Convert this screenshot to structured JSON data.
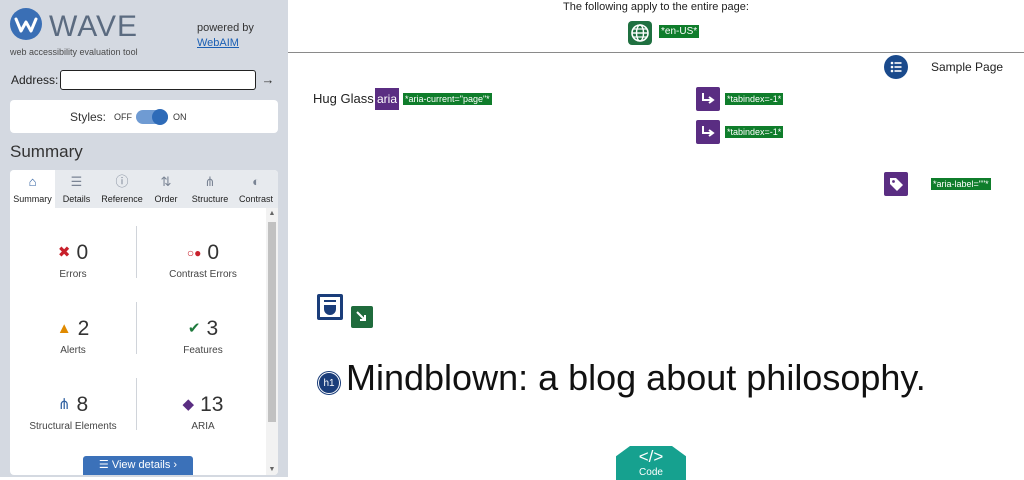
{
  "sidebar": {
    "logo_text": "WAVE",
    "logo_subtitle": "web accessibility evaluation tool",
    "powered_by": "powered by",
    "webaim_link": "WebAIM",
    "address_label": "Address:",
    "address_value": "",
    "go_arrow": "→",
    "styles_label": "Styles:",
    "styles_off": "OFF",
    "styles_on": "ON",
    "summary_title": "Summary",
    "tabs": [
      {
        "label": "Summary",
        "icon": "home-icon",
        "glyph": "⌂",
        "active": true
      },
      {
        "label": "Details",
        "icon": "list-icon",
        "glyph": "☰",
        "active": false
      },
      {
        "label": "Reference",
        "icon": "info-icon",
        "glyph": "ⓘ",
        "active": false
      },
      {
        "label": "Order",
        "icon": "order-icon",
        "glyph": "⇅",
        "active": false
      },
      {
        "label": "Structure",
        "icon": "structure-icon",
        "glyph": "⋔",
        "active": false
      },
      {
        "label": "Contrast",
        "icon": "contrast-icon",
        "glyph": "◐",
        "active": false
      }
    ],
    "stats": [
      {
        "count": "0",
        "label": "Errors",
        "icon": "error-icon",
        "glyph": "✖",
        "color": "#c8202b"
      },
      {
        "count": "0",
        "label": "Contrast Errors",
        "icon": "contrast-error-icon",
        "glyph": "○●",
        "color": "#c8202b"
      },
      {
        "count": "2",
        "label": "Alerts",
        "icon": "alert-icon",
        "glyph": "▲",
        "color": "#e08a00"
      },
      {
        "count": "3",
        "label": "Features",
        "icon": "feature-icon",
        "glyph": "✔",
        "color": "#1f7a3d"
      },
      {
        "count": "8",
        "label": "Structural Elements",
        "icon": "structure-icon",
        "glyph": "⋔",
        "color": "#2e5fa0"
      },
      {
        "count": "13",
        "label": "ARIA",
        "icon": "aria-icon",
        "glyph": "◆",
        "color": "#5a2d82"
      }
    ],
    "view_details": "☰  View details ›"
  },
  "content": {
    "page_note": "The following apply to the entire page:",
    "lang_tag": "*en-US*",
    "sample_page": "Sample Page",
    "hug_glass": "Hug Glass",
    "aria_badge": "aria",
    "aria_current_tag": "*aria-current=\"page\"*",
    "tabindex_tag_1": "*tabindex=-1*",
    "tabindex_tag_2": "*tabindex=-1*",
    "aria_label_tag": "*aria-label=\"\"*",
    "h1_badge": "h1",
    "h1_text": "Mindblown: a blog about philosophy.",
    "code_symbol": "</>",
    "code_label": "Code"
  },
  "colors": {
    "accent_blue": "#2e6bb8",
    "feature_green": "#0f7d2b",
    "aria_purple": "#5a2d82",
    "error_red": "#c8202b",
    "alert_orange": "#e08a00",
    "code_teal": "#16a18f"
  }
}
